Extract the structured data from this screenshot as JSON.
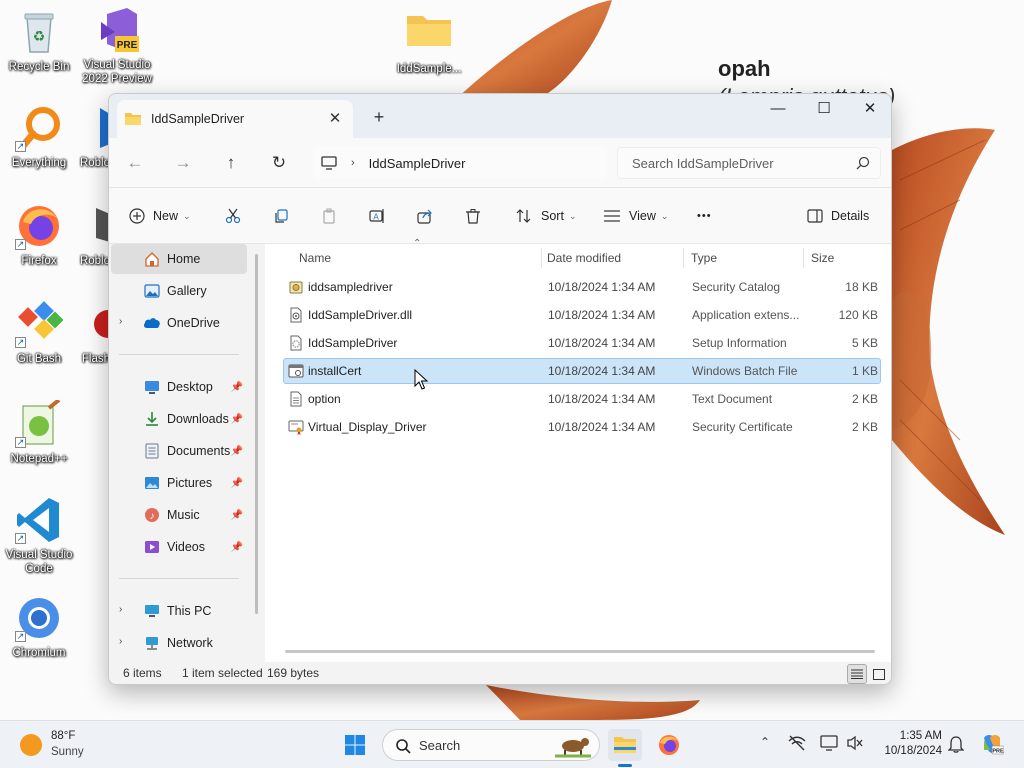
{
  "desktop": {
    "wallpaper_title": "opah",
    "wallpaper_subtitle": "(Lampris guttatus)",
    "icons": [
      {
        "label": "Recycle Bin"
      },
      {
        "label": "Visual Studio 2022 Preview",
        "badge": "PRE"
      },
      {
        "label": "IddSample..."
      },
      {
        "label": "Everything"
      },
      {
        "label": "Roblo"
      },
      {
        "label": "Firefox"
      },
      {
        "label": "Roblo"
      },
      {
        "label": "Git Bash"
      },
      {
        "label": "Flash"
      },
      {
        "label": "Notepad++"
      },
      {
        "label": "Visual Studio Code"
      },
      {
        "label": "Chromium"
      }
    ]
  },
  "window": {
    "tab_title": "IddSampleDriver",
    "controls": {
      "minimize": "—",
      "maximize": "☐",
      "close": "✕"
    },
    "address_path": "IddSampleDriver",
    "search_placeholder": "Search IddSampleDriver",
    "toolbar": {
      "new": "New",
      "sort": "Sort",
      "view": "View",
      "more": "•••",
      "details": "Details"
    },
    "sidebar": {
      "home": "Home",
      "gallery": "Gallery",
      "onedrive": "OneDrive",
      "desktop": "Desktop",
      "downloads": "Downloads",
      "documents": "Documents",
      "pictures": "Pictures",
      "music": "Music",
      "videos": "Videos",
      "this_pc": "This PC",
      "network": "Network"
    },
    "columns": {
      "name": "Name",
      "date": "Date modified",
      "type": "Type",
      "size": "Size"
    },
    "files": [
      {
        "name": "iddsampledriver",
        "date": "10/18/2024 1:34 AM",
        "type": "Security Catalog",
        "size": "18 KB",
        "icon": "catalog-icon"
      },
      {
        "name": "IddSampleDriver.dll",
        "date": "10/18/2024 1:34 AM",
        "type": "Application extens...",
        "size": "120 KB",
        "icon": "dll-icon"
      },
      {
        "name": "IddSampleDriver",
        "date": "10/18/2024 1:34 AM",
        "type": "Setup Information",
        "size": "5 KB",
        "icon": "inf-icon"
      },
      {
        "name": "installCert",
        "date": "10/18/2024 1:34 AM",
        "type": "Windows Batch File",
        "size": "1 KB",
        "icon": "batch-icon",
        "selected": true
      },
      {
        "name": "option",
        "date": "10/18/2024 1:34 AM",
        "type": "Text Document",
        "size": "2 KB",
        "icon": "text-icon"
      },
      {
        "name": "Virtual_Display_Driver",
        "date": "10/18/2024 1:34 AM",
        "type": "Security Certificate",
        "size": "2 KB",
        "icon": "certificate-icon"
      }
    ],
    "status": {
      "items": "6 items",
      "selected": "1 item selected",
      "bytes": "169 bytes"
    }
  },
  "taskbar": {
    "weather_temp": "88°F",
    "weather_cond": "Sunny",
    "search_label": "Search",
    "clock_time": "1:35 AM",
    "clock_date": "10/18/2024"
  },
  "colors": {
    "accent": "#0078d4",
    "selection": "#cce4f7",
    "fish": "#c25a2c"
  }
}
